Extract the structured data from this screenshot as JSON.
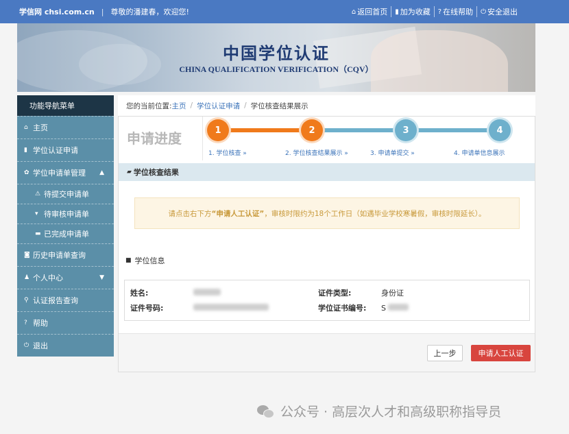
{
  "topbar": {
    "site": "学信网 chsi.com.cn",
    "sep": "|",
    "welcome": "尊敬的潘建春，欢迎您!",
    "links": [
      {
        "icon": "home-icon",
        "glyph": "⌂",
        "label": "返回首页"
      },
      {
        "icon": "bookmark-icon",
        "glyph": "▮",
        "label": "加为收藏"
      },
      {
        "icon": "help-icon",
        "glyph": "?",
        "label": "在线帮助"
      },
      {
        "icon": "power-icon",
        "glyph": "⏻",
        "label": "安全退出"
      }
    ]
  },
  "banner": {
    "title_cn": "中国学位认证",
    "title_en": "CHINA QUALIFICATION VERIFICATION（CQV）"
  },
  "sidebar": {
    "header": "功能导航菜单",
    "items": [
      {
        "label": "主页",
        "glyph": "⌂",
        "icon": "home-icon"
      },
      {
        "label": "学位认证申请",
        "glyph": "▮",
        "icon": "file-icon"
      },
      {
        "label": "学位申请单管理",
        "glyph": "✿",
        "icon": "gear-icon",
        "chevron": "▲"
      },
      {
        "label": "待提交申请单",
        "glyph": "⚠",
        "icon": "warning-icon"
      },
      {
        "label": "待审核申请单",
        "glyph": "▾",
        "icon": "cart-icon"
      },
      {
        "label": "已完成申请单",
        "glyph": "▬",
        "icon": "inbox-icon"
      },
      {
        "label": "历史申请单查询",
        "glyph": "◙",
        "icon": "camera-icon"
      },
      {
        "label": "个人中心",
        "glyph": "♟",
        "icon": "user-icon",
        "chevron": "▼"
      },
      {
        "label": "认证报告查询",
        "glyph": "⚲",
        "icon": "search-icon"
      },
      {
        "label": "帮助",
        "glyph": "?",
        "icon": "help-icon"
      },
      {
        "label": "退出",
        "glyph": "⏻",
        "icon": "power-icon"
      }
    ]
  },
  "breadcrumb": {
    "prefix": "您的当前位置:",
    "items": [
      "主页",
      "学位认证申请",
      "学位核查结果展示"
    ],
    "sep": "/"
  },
  "progress": {
    "title": "申请进度",
    "steps": [
      {
        "num": "1",
        "label": "1. 学位核查  »",
        "state": "done"
      },
      {
        "num": "2",
        "label": "2. 学位核查结果展示  »",
        "state": "done"
      },
      {
        "num": "3",
        "label": "3. 申请单提交  »",
        "state": "todo"
      },
      {
        "num": "4",
        "label": "4. 申请单信息展示",
        "state": "todo"
      }
    ]
  },
  "result_section": {
    "icon_glyph": "▰",
    "title": "学位核查结果"
  },
  "notice": {
    "before": "请点击右下方",
    "highlight": "“申请人工认证”",
    "after": "，审核时限约为18个工作日（如遇毕业学校寒暑假，审核时限延长）。"
  },
  "info_section": {
    "icon_glyph": "■",
    "title": "学位信息",
    "name_label": "姓名:",
    "id_type_label": "证件类型:",
    "id_type_value": "身份证",
    "id_number_label": "证件号码:",
    "cert_number_label": "学位证书编号:",
    "cert_number_prefix": "S"
  },
  "buttons": {
    "prev": "上一步",
    "apply": "申请人工认证"
  },
  "watermark": {
    "text": "公众号 · 高层次人才和高级职称指导员"
  },
  "colors": {
    "topbar": "#4a79c2",
    "sidebar": "#5b8fa8",
    "sidebar_header": "#1d3546",
    "step_done": "#f07a1b",
    "step_todo": "#6eb0cc",
    "apply_button": "#d8453e",
    "notice_bg": "#fdf5e4"
  }
}
